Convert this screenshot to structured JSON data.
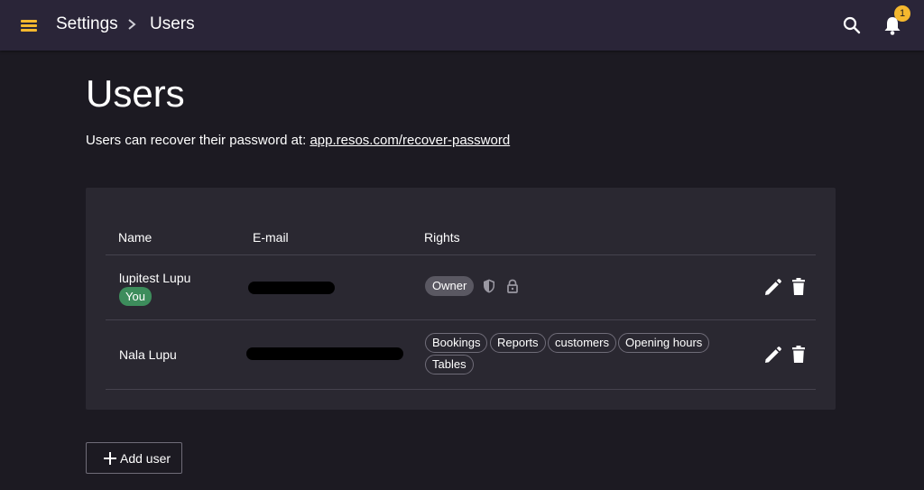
{
  "header": {
    "breadcrumb": [
      "Settings",
      "Users"
    ],
    "notification_count": "1",
    "accent_color": "#f5b82e"
  },
  "page": {
    "title": "Users",
    "recover_text": "Users can recover their password at:",
    "recover_link": "app.resos.com/recover-password"
  },
  "table": {
    "columns": [
      "Name",
      "E-mail",
      "Rights"
    ],
    "rows": [
      {
        "name": "lupitest Lupu",
        "badge": "You",
        "email": "[redacted]",
        "rights": [
          "Owner"
        ],
        "icons": [
          "shield-icon",
          "lock-icon"
        ]
      },
      {
        "name": "Nala Lupu",
        "email": "[redacted]",
        "rights": [
          "Bookings",
          "Reports",
          "customers",
          "Opening hours",
          "Tables"
        ]
      }
    ]
  },
  "actions": {
    "add_user_label": "Add user"
  }
}
